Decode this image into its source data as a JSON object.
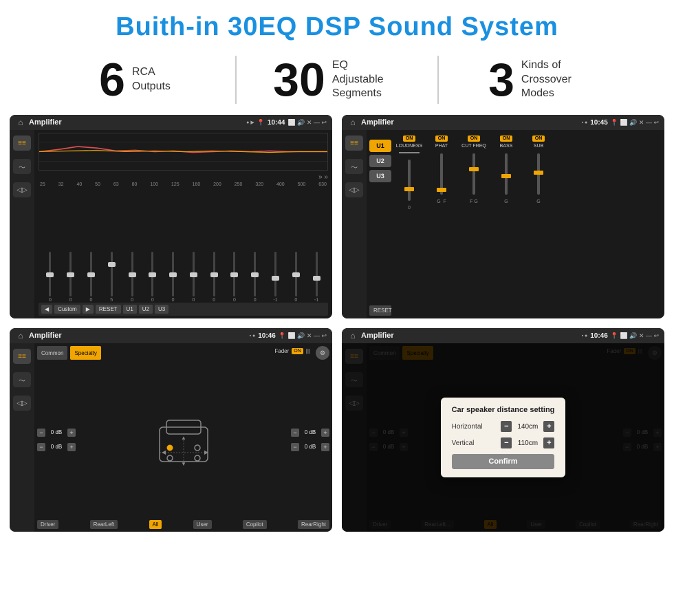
{
  "title": "Buith-in 30EQ DSP Sound System",
  "stats": [
    {
      "number": "6",
      "text": "RCA\nOutputs"
    },
    {
      "number": "30",
      "text": "EQ Adjustable\nSegments"
    },
    {
      "number": "3",
      "text": "Kinds of\nCrossover Modes"
    }
  ],
  "screens": [
    {
      "id": "eq-screen",
      "statusBar": {
        "appName": "Amplifier",
        "time": "10:44",
        "icons": [
          "▶",
          "◉",
          "📍",
          "⬜",
          "🔊",
          "✕",
          "—",
          "↩"
        ]
      },
      "type": "eq",
      "freqLabels": [
        "25",
        "32",
        "40",
        "50",
        "63",
        "80",
        "100",
        "125",
        "160",
        "200",
        "250",
        "320",
        "400",
        "500",
        "630"
      ],
      "sliderValues": [
        "0",
        "0",
        "0",
        "5",
        "0",
        "0",
        "0",
        "0",
        "0",
        "0",
        "0",
        "-1",
        "0",
        "-1"
      ],
      "bottomButtons": [
        "◀",
        "Custom",
        "▶",
        "RESET",
        "U1",
        "U2",
        "U3"
      ]
    },
    {
      "id": "amp-screen",
      "statusBar": {
        "appName": "Amplifier",
        "time": "10:45",
        "icons": [
          "◉",
          "▪",
          "📍",
          "⬜",
          "🔊",
          "✕",
          "—",
          "↩"
        ]
      },
      "type": "amplifier",
      "channels": [
        "U1",
        "U2",
        "U3"
      ],
      "panels": [
        {
          "label": "LOUDNESS",
          "on": true
        },
        {
          "label": "PHAT",
          "on": true
        },
        {
          "label": "CUT FREQ",
          "on": true
        },
        {
          "label": "BASS",
          "on": true
        },
        {
          "label": "SUB",
          "on": true
        }
      ],
      "resetLabel": "RESET"
    },
    {
      "id": "speaker-screen",
      "statusBar": {
        "appName": "Amplifier",
        "time": "10:46",
        "icons": [
          "◉",
          "▪",
          "📍",
          "⬜",
          "🔊",
          "✕",
          "—",
          "↩"
        ]
      },
      "type": "speaker",
      "tabs": [
        "Common",
        "Specialty"
      ],
      "faderLabel": "Fader",
      "faderOn": true,
      "volControls": [
        {
          "value": "0 dB"
        },
        {
          "value": "0 dB"
        },
        {
          "value": "0 dB"
        },
        {
          "value": "0 dB"
        }
      ],
      "bottomButtons": [
        "Driver",
        "RearLeft",
        "All",
        "User",
        "Copilot",
        "RearRight"
      ]
    },
    {
      "id": "speaker-dialog-screen",
      "statusBar": {
        "appName": "Amplifier",
        "time": "10:46",
        "icons": [
          "◉",
          "▪",
          "📍",
          "⬜",
          "🔊",
          "✕",
          "—",
          "↩"
        ]
      },
      "type": "speaker-dialog",
      "tabs": [
        "Common",
        "Specialty"
      ],
      "dialog": {
        "title": "Car speaker distance setting",
        "fields": [
          {
            "label": "Horizontal",
            "value": "140cm"
          },
          {
            "label": "Vertical",
            "value": "110cm"
          }
        ],
        "confirmLabel": "Confirm"
      },
      "bottomButtons": [
        "Driver",
        "RearLeft...",
        "All",
        "User",
        "Copilot",
        "RearRight"
      ]
    }
  ]
}
